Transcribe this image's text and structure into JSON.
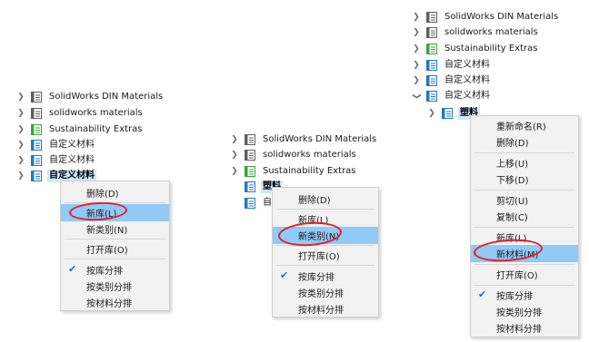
{
  "colors": {
    "folder_gray": "#5f5f5f",
    "folder_blue": "#1f7ac1",
    "folder_green": "#3aa43a",
    "selection": "#cce8ff",
    "menu_highlight": "#91c9f7",
    "annotation_red": "#e0202a"
  },
  "icons": {
    "expand": "chevron-right-icon",
    "collapse": "chevron-down-icon",
    "library": "material-library-icon",
    "check": "check-icon"
  },
  "panel1": {
    "tree": [
      {
        "label": "SolidWorks DIN Materials"
      },
      {
        "label": "solidworks materials"
      },
      {
        "label": "Sustainability Extras"
      },
      {
        "label": "自定义材料"
      },
      {
        "label": "自定义材料"
      },
      {
        "label": "自定义材料"
      }
    ],
    "menu": {
      "delete": "删除(D)",
      "new_library": "新库(L)",
      "new_category": "新类别(N)",
      "open_library": "打开库(O)",
      "sort_by_library": "按库分排",
      "sort_by_category": "按类别分排",
      "sort_by_material": "按材料分排"
    }
  },
  "panel2": {
    "tree": [
      {
        "label": "SolidWorks DIN Materials"
      },
      {
        "label": "solidworks materials"
      },
      {
        "label": "Sustainability Extras"
      },
      {
        "label": "塑料"
      },
      {
        "label": "自"
      }
    ],
    "menu": {
      "delete": "删除(D)",
      "new_library": "新库(L)",
      "new_category": "新类别(N)",
      "open_library": "打开库(O)",
      "sort_by_library": "按库分排",
      "sort_by_category": "按类别分排",
      "sort_by_material": "按材料分排"
    }
  },
  "panel3": {
    "tree": [
      {
        "label": "SolidWorks DIN Materials"
      },
      {
        "label": "solidworks materials"
      },
      {
        "label": "Sustainability Extras"
      },
      {
        "label": "自定义材料"
      },
      {
        "label": "自定义材料"
      },
      {
        "label": "自定义材料"
      },
      {
        "label": "塑料"
      }
    ],
    "menu": {
      "rename": "重新命名(R)",
      "delete": "删除(D)",
      "move_up": "上移(U)",
      "move_down": "下移(D)",
      "cut": "剪切(U)",
      "copy": "复制(C)",
      "new_library": "新库(L)",
      "new_material": "新材料(M)",
      "open_library": "打开库(O)",
      "sort_by_library": "按库分排",
      "sort_by_category": "按类别分排",
      "sort_by_material": "按材料分排"
    }
  }
}
